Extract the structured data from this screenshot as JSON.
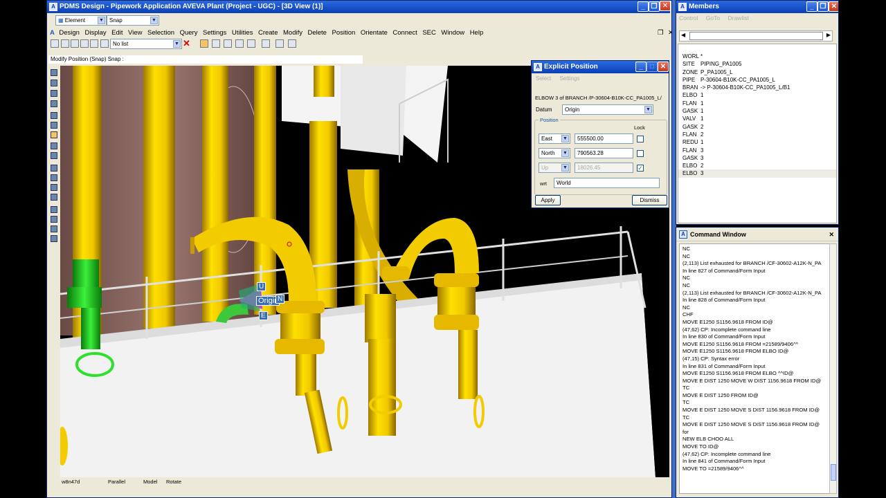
{
  "main_window": {
    "title": "PDMS Design - Pipework Application   AVEVA Plant (Project - UGC) - [3D View (1)]",
    "element_combo": "Element",
    "snap_combo": "Snap",
    "menu": [
      "Design",
      "Display",
      "Edit",
      "View",
      "Selection",
      "Query",
      "Settings",
      "Utilities",
      "Create",
      "Modify",
      "Delete",
      "Position",
      "Orientate",
      "Connect",
      "SEC",
      "Window",
      "Help"
    ],
    "list_combo": "No list",
    "prompt": "Modify Position (Snap) Snap :"
  },
  "viewport": {
    "status": [
      "w8n47d",
      "Parallel",
      "Model",
      "Rotate"
    ],
    "gizmo": {
      "up": "U",
      "north": "N",
      "east": "E",
      "label": "Origin"
    }
  },
  "explicit_position": {
    "title": "Explicit Position",
    "menu": [
      "Select",
      "Settings"
    ],
    "element_text": "ELBOW 3 of BRANCH /P-30604-B10K-CC_PA1005_L/",
    "datum_label": "Datum",
    "datum_value": "Origin",
    "position_group": "Position",
    "lock_label": "Lock",
    "rows": [
      {
        "dir": "East",
        "value": "555500.00",
        "locked": false
      },
      {
        "dir": "North",
        "value": "790563.28",
        "locked": false
      },
      {
        "dir": "Up",
        "value": "18026.45",
        "locked": true
      }
    ],
    "wrt_label": "wrt",
    "wrt_value": "World",
    "apply_label": "Apply",
    "dismiss_label": "Dismiss"
  },
  "members": {
    "title": "Members",
    "menu": [
      "Control",
      "GoTo",
      "Drawlist"
    ],
    "items": [
      {
        "type": "WORL",
        "name": "*"
      },
      {
        "type": "SITE",
        "name": "PIPING_PA1005"
      },
      {
        "type": "ZONE",
        "name": "P_PA1005_L"
      },
      {
        "type": "PIPE",
        "name": "P-30604-B10K-CC_PA1005_L"
      },
      {
        "type": "BRAN",
        "name": "-> P-30604-B10K-CC_PA1005_L/B1"
      },
      {
        "type": "ELBO",
        "name": "1"
      },
      {
        "type": "FLAN",
        "name": "1"
      },
      {
        "type": "GASK",
        "name": "1"
      },
      {
        "type": "VALV",
        "name": "1"
      },
      {
        "type": "GASK",
        "name": "2"
      },
      {
        "type": "FLAN",
        "name": "2"
      },
      {
        "type": "REDU",
        "name": "1"
      },
      {
        "type": "FLAN",
        "name": "3"
      },
      {
        "type": "GASK",
        "name": "3"
      },
      {
        "type": "ELBO",
        "name": "2"
      },
      {
        "type": "ELBO",
        "name": "3"
      }
    ]
  },
  "command_window": {
    "title": "Command Window",
    "lines": [
      "NC",
      "NC",
      "(2,113)   List exhausted for BRANCH /CF-30602-A12K-N_PA",
      " In line 827 of Command/Form Input",
      "NC",
      "NC",
      "(2,113)   List exhausted for BRANCH /CF-30602-A12K-N_PA",
      " In line 828 of Command/Form Input",
      "NC",
      "CHF",
      "MOVE E1250 S1156.9618 FROM ID@",
      "(47,62)    CP: Incomplete command line",
      " In line 830 of Command/Form Input",
      "MOVE E1250 S1156.9618 FROM =21589/9406^^",
      "MOVE E1250 S1156.9618 FROM ELBO ID@",
      "(47,15)    CP: Syntax error",
      " In line 831 of Command/Form Input",
      "MOVE E1250 S1156.9618 FROM ELBO ^^ID@",
      "MOVE E DIST 1250 MOVE W DIST 1156.9618 FROM ID@",
      "TC",
      "MOVE E DIST 1250 FROM ID@",
      "TC",
      "MOVE E DIST 1250 MOVE S DIST 1156.9618 FROM ID@",
      "TC",
      "MOVE E DIST 1250 MOVE S DIST 1156.9618 FROM ID@",
      "for",
      "NEW ELB CHOO ALL",
      "MOVE TO ID@",
      "(47,62)    CP: Incomplete command line",
      " In line 841 of Command/Form Input",
      "MOVE TO =21589/9406^^"
    ]
  }
}
